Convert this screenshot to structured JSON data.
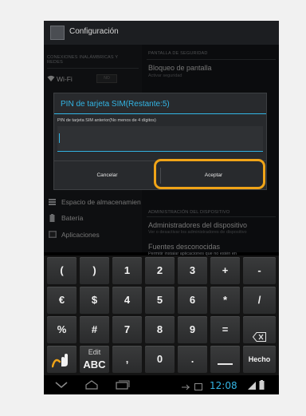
{
  "action_bar": {
    "title": "Configuración"
  },
  "left_pane": {
    "section_header_line1": "CONEXIONES INALÁMBRICAS Y",
    "section_header_line2": "REDES",
    "wifi_label": "Wi-Fi",
    "wifi_toggle": "NO",
    "items": [
      {
        "label": "Espacio de almacenamiento",
        "icon": "storage-icon"
      },
      {
        "label": "Batería",
        "icon": "battery-icon"
      },
      {
        "label": "Aplicaciones",
        "icon": "apps-icon"
      }
    ]
  },
  "right_pane": {
    "section_header": "PANTALLA DE SEGURIDAD",
    "screen_lock_title": "Bloqueo de pantalla",
    "screen_lock_sub": "Activar seguridad",
    "admin_header": "ADMINISTRACIÓN DEL DISPOSITIVO",
    "admins_title": "Administradores del dispositivo",
    "admins_sub": "Ver o desactivar los administradores de dispositivo",
    "unknown_sources_title": "Fuentes desconocidas",
    "unknown_sources_sub": "Permitir instalar aplicaciones que no estén en Android Market"
  },
  "dialog": {
    "title": "PIN de tarjeta SIM(Restante:5)",
    "field_label": "PIN de tarjeta SIM anterior(No menos de 4 dígitos)",
    "input_value": "",
    "cancel_label": "Cancelar",
    "accept_label": "Aceptar"
  },
  "keyboard": {
    "row1": [
      "(",
      ")",
      "1",
      "2",
      "3",
      "+",
      "-"
    ],
    "row2": [
      "€",
      "$",
      "4",
      "5",
      "6",
      "*",
      "/"
    ],
    "row3": [
      "%",
      "#",
      "7",
      "8",
      "9",
      "="
    ],
    "row4": [
      ",",
      "0",
      "."
    ],
    "abc_top": "Edit",
    "abc_bottom": "ABC",
    "done_label": "Hecho",
    "backspace_icon": "backspace-icon",
    "gesture_icon": "hand-gesture-icon",
    "space_icon": "space-icon"
  },
  "nav_bar": {
    "clock": "12:08",
    "icons": [
      "back-icon",
      "home-icon",
      "recent-apps-icon"
    ]
  },
  "colors": {
    "accent": "#33b5e5",
    "highlight": "#f0a418"
  }
}
